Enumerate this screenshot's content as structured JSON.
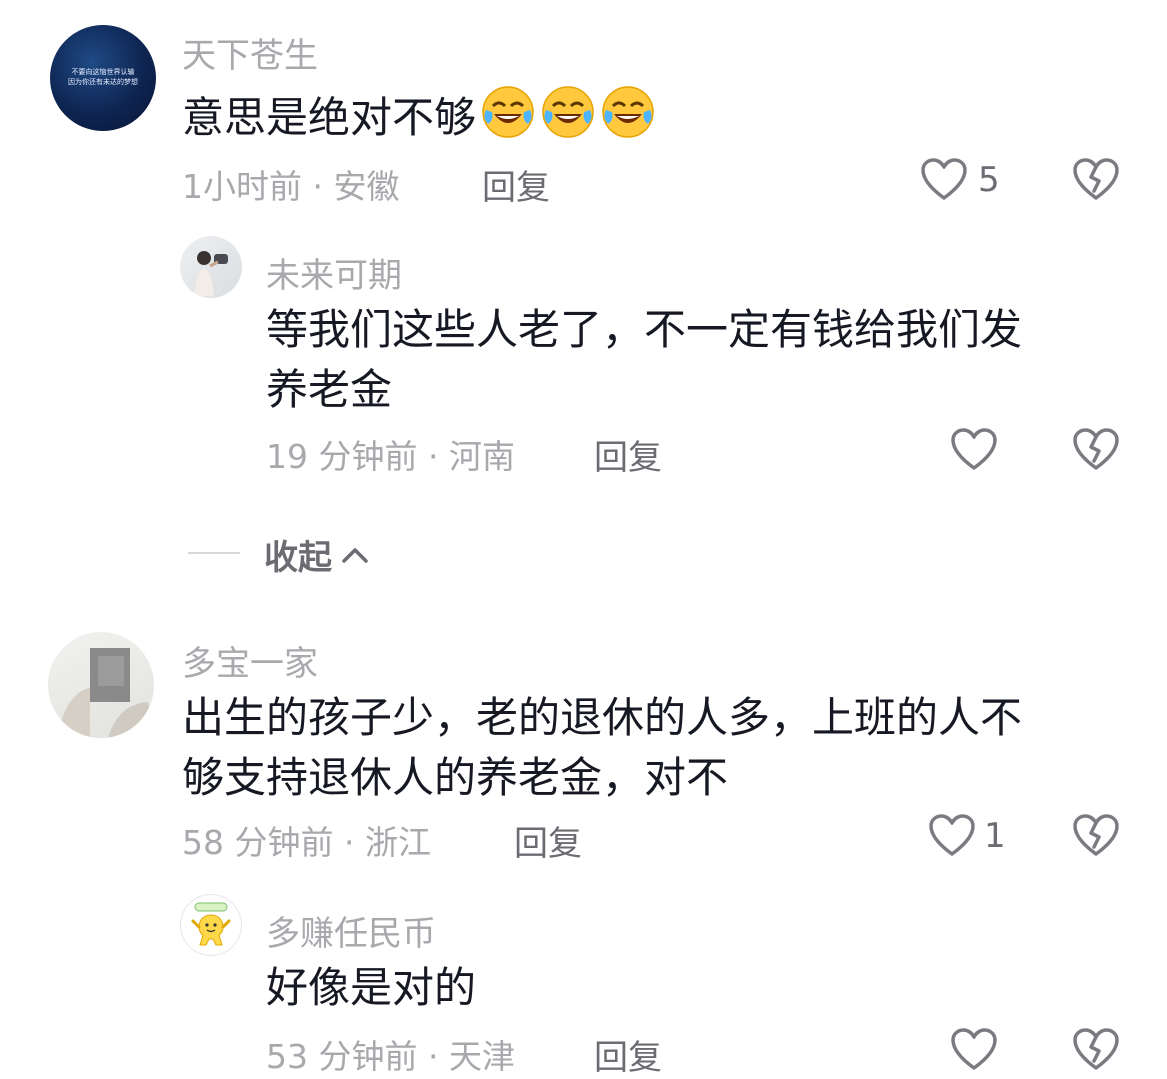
{
  "comments": [
    {
      "username": "天下苍生",
      "avatar_text_line1": "不要向这恼世界认输",
      "avatar_text_line2": "因为你还有未达的梦想",
      "text": "意思是绝对不够",
      "emoji": [
        "crying-laughing-emoji",
        "crying-laughing-emoji",
        "crying-laughing-emoji"
      ],
      "time_location": "1小时前 · 安徽",
      "reply_label": "回复",
      "like_count": "5",
      "replies": [
        {
          "username": "未来可期",
          "text_line1": "等我们这些人老了，不一定有钱给我们发",
          "text_line2": "养老金",
          "time_location": "19 分钟前 · 河南",
          "reply_label": "回复",
          "like_count": ""
        }
      ]
    },
    {
      "username": "多宝一家",
      "text_line1": "出生的孩子少，老的退休的人多，上班的人不",
      "text_line2": "够支持退休人的养老金，对不",
      "time_location": "58 分钟前 · 浙江",
      "reply_label": "回复",
      "like_count": "1",
      "replies": [
        {
          "username": "多赚任民币",
          "text": "好像是对的",
          "time_location": "53 分钟前 · 天津",
          "reply_label": "回复",
          "like_count": ""
        }
      ]
    }
  ],
  "collapse_label": "收起",
  "colors": {
    "text": "#161823",
    "muted": "#a8a8ad",
    "action": "#6b6b72",
    "icon": "#7a7a80"
  },
  "icons": [
    "heart-outline-icon",
    "broken-heart-icon",
    "chevron-up-icon"
  ]
}
